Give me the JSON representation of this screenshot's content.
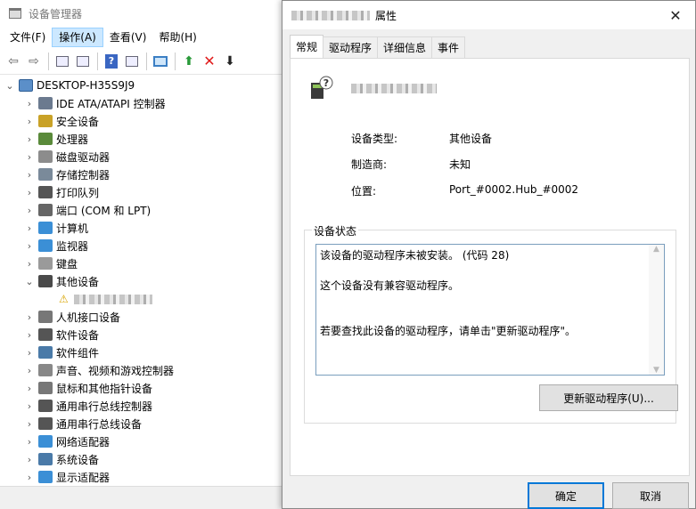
{
  "device_manager": {
    "title": "设备管理器",
    "menu": [
      "文件(F)",
      "操作(A)",
      "查看(V)",
      "帮助(H)"
    ],
    "toolbar_icons": [
      "back-icon",
      "forward-icon",
      "properties-icon",
      "list-icon",
      "help-icon",
      "view-icon",
      "scan-hardware-icon",
      "update-driver-icon",
      "uninstall-icon",
      "download-icon"
    ],
    "tree": {
      "root": "DESKTOP-H35S9J9",
      "categories": [
        {
          "label": "IDE ATA/ATAPI 控制器",
          "icon": "ide-controller-icon",
          "color": "#6b7a8f",
          "expanded": false
        },
        {
          "label": "安全设备",
          "icon": "security-device-icon",
          "color": "#c9a227",
          "expanded": false
        },
        {
          "label": "处理器",
          "icon": "processor-icon",
          "color": "#5a8a3a",
          "expanded": false
        },
        {
          "label": "磁盘驱动器",
          "icon": "disk-drive-icon",
          "color": "#8c8c8c",
          "expanded": false
        },
        {
          "label": "存储控制器",
          "icon": "storage-controller-icon",
          "color": "#7a8a9a",
          "expanded": false
        },
        {
          "label": "打印队列",
          "icon": "printer-icon",
          "color": "#555555",
          "expanded": false
        },
        {
          "label": "端口 (COM 和 LPT)",
          "icon": "port-icon",
          "color": "#666666",
          "expanded": false
        },
        {
          "label": "计算机",
          "icon": "computer-icon",
          "color": "#3b8fd6",
          "expanded": false
        },
        {
          "label": "监视器",
          "icon": "monitor-icon",
          "color": "#3b8fd6",
          "expanded": false
        },
        {
          "label": "键盘",
          "icon": "keyboard-icon",
          "color": "#9a9a9a",
          "expanded": false
        },
        {
          "label": "其他设备",
          "icon": "other-devices-icon",
          "color": "#4a4a4a",
          "expanded": true
        },
        {
          "label": "人机接口设备",
          "icon": "hid-icon",
          "color": "#777777",
          "expanded": false
        },
        {
          "label": "软件设备",
          "icon": "software-device-icon",
          "color": "#555555",
          "expanded": false
        },
        {
          "label": "软件组件",
          "icon": "software-component-icon",
          "color": "#4a7aa8",
          "expanded": false
        },
        {
          "label": "声音、视频和游戏控制器",
          "icon": "sound-icon",
          "color": "#888888",
          "expanded": false
        },
        {
          "label": "鼠标和其他指针设备",
          "icon": "mouse-icon",
          "color": "#777777",
          "expanded": false
        },
        {
          "label": "通用串行总线控制器",
          "icon": "usb-controller-icon",
          "color": "#555555",
          "expanded": false
        },
        {
          "label": "通用串行总线设备",
          "icon": "usb-device-icon",
          "color": "#555555",
          "expanded": false
        },
        {
          "label": "网络适配器",
          "icon": "network-adapter-icon",
          "color": "#3b8fd6",
          "expanded": false
        },
        {
          "label": "系统设备",
          "icon": "system-device-icon",
          "color": "#4a7aa8",
          "expanded": false
        },
        {
          "label": "显示适配器",
          "icon": "display-adapter-icon",
          "color": "#3b8fd6",
          "expanded": false
        }
      ]
    }
  },
  "dialog": {
    "title_suffix": "属性",
    "close_glyph": "✕",
    "tabs": [
      "常规",
      "驱动程序",
      "详细信息",
      "事件"
    ],
    "active_tab": 0,
    "properties": [
      {
        "label": "设备类型:",
        "value": "其他设备"
      },
      {
        "label": "制造商:",
        "value": "未知"
      },
      {
        "label": "位置:",
        "value": "Port_#0002.Hub_#0002"
      }
    ],
    "status_group_label": "设备状态",
    "status_lines": [
      "该设备的驱动程序未被安装。 (代码 28)",
      "",
      "这个设备没有兼容驱动程序。",
      "",
      "",
      "若要查找此设备的驱动程序，请单击\"更新驱动程序\"。"
    ],
    "update_button": "更新驱动程序(U)...",
    "ok_button": "确定",
    "cancel_button": "取消"
  }
}
